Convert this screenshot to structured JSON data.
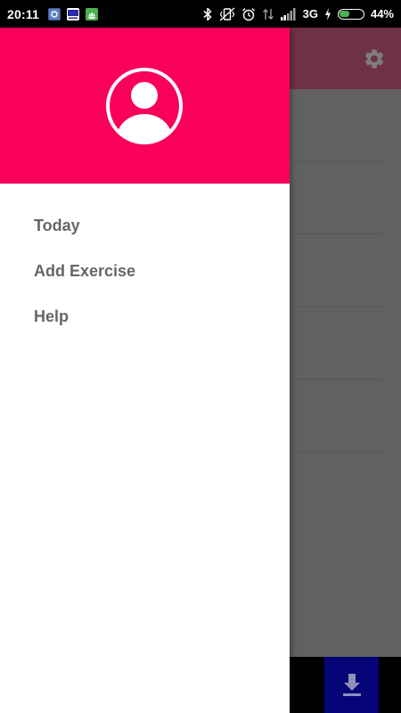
{
  "status_bar": {
    "time": "20:11",
    "network": "3G",
    "battery_percent": "44%",
    "battery_level": 0.44,
    "notification_icons": [
      "photo-notification-icon",
      "news-notification-icon",
      "android-notification-icon"
    ],
    "system_icons": [
      "bluetooth-icon",
      "vibrate-icon",
      "alarm-icon",
      "data-arrows-icon",
      "signal-icon",
      "charging-icon",
      "battery-icon"
    ]
  },
  "drawer": {
    "header_color": "#f9005b",
    "avatar_icon": "account-circle-icon",
    "items": [
      {
        "label": "Today"
      },
      {
        "label": "Add Exercise"
      },
      {
        "label": "Help"
      }
    ]
  },
  "background_app": {
    "toolbar_icon": "settings-gear-icon",
    "fab_icon": "download-icon",
    "accent": "#f9005b",
    "fab_color": "#050577"
  }
}
